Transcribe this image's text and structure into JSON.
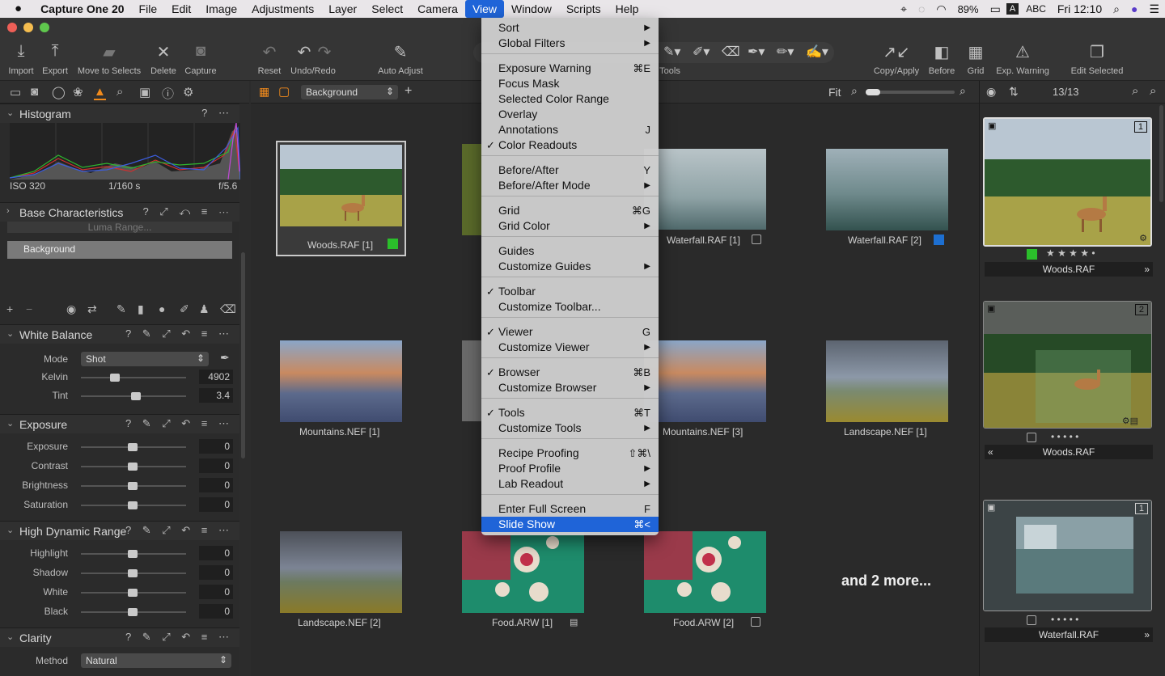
{
  "menubar": {
    "apple": "",
    "app_name": "Capture One 20",
    "items": [
      "File",
      "Edit",
      "Image",
      "Adjustments",
      "Layer",
      "Select",
      "Camera",
      "View",
      "Window",
      "Scripts",
      "Help"
    ],
    "battery": "89%",
    "input": "ABC",
    "clock": "Fri 12:10"
  },
  "toolbar": {
    "import": "Import",
    "export": "Export",
    "move_to_selects": "Move to Selects",
    "delete": "Delete",
    "capture": "Capture",
    "reset": "Reset",
    "undo_redo": "Undo/Redo",
    "auto_adjust": "Auto Adjust",
    "tools": "Tools",
    "copy_apply": "Copy/Apply",
    "before": "Before",
    "grid": "Grid",
    "exp_warning": "Exp. Warning",
    "edit_selected": "Edit Selected"
  },
  "histogram": {
    "title": "Histogram",
    "iso": "ISO 320",
    "shutter": "1/160 s",
    "aperture": "f/5.6"
  },
  "base_characteristics": {
    "title": "Base Characteristics",
    "luma_range": "Luma Range...",
    "layer": "Background"
  },
  "white_balance": {
    "title": "White Balance",
    "mode_label": "Mode",
    "mode_value": "Shot",
    "kelvin_label": "Kelvin",
    "kelvin_value": "4902",
    "tint_label": "Tint",
    "tint_value": "3.4"
  },
  "exposure": {
    "title": "Exposure",
    "rows": [
      {
        "label": "Exposure",
        "value": "0"
      },
      {
        "label": "Contrast",
        "value": "0"
      },
      {
        "label": "Brightness",
        "value": "0"
      },
      {
        "label": "Saturation",
        "value": "0"
      }
    ]
  },
  "hdr": {
    "title": "High Dynamic Range",
    "rows": [
      {
        "label": "Highlight",
        "value": "0"
      },
      {
        "label": "Shadow",
        "value": "0"
      },
      {
        "label": "White",
        "value": "0"
      },
      {
        "label": "Black",
        "value": "0"
      }
    ]
  },
  "clarity": {
    "title": "Clarity",
    "method_label": "Method",
    "method_value": "Natural"
  },
  "browser": {
    "layer_select": "Background",
    "fit": "Fit",
    "more": "and 2 more...",
    "thumbs": [
      {
        "name": "Woods.RAF [1]"
      },
      {
        "name": "Waterfall.RAF [1]"
      },
      {
        "name": "Waterfall.RAF [2]"
      },
      {
        "name": "Mountains.NEF [1]"
      },
      {
        "name": "Mountains.NEF [3]"
      },
      {
        "name": "Landscape.NEF [1]"
      },
      {
        "name": "Landscape.NEF [2]"
      },
      {
        "name": "Food.ARW [1]"
      },
      {
        "name": "Food.ARW [2]"
      }
    ]
  },
  "viewer_panel": {
    "count": "13/13",
    "badge1": "1",
    "badge2": "2",
    "badge3": "1",
    "name1": "Woods.RAF",
    "name2": "Woods.RAF",
    "name3": "Waterfall.RAF",
    "stars": "★ ★ ★ ★ •",
    "dots": "• • • • •"
  },
  "view_menu": {
    "items": [
      {
        "label": "Sort",
        "shortcut": "▶"
      },
      {
        "label": "Global Filters",
        "shortcut": "▶"
      },
      {
        "label": "Exposure Warning",
        "shortcut": "⌘E"
      },
      {
        "label": "Focus Mask",
        "shortcut": ""
      },
      {
        "label": "Selected Color Range",
        "shortcut": ""
      },
      {
        "label": "Overlay",
        "shortcut": ""
      },
      {
        "label": "Annotations",
        "shortcut": "J"
      },
      {
        "label": "Color Readouts",
        "shortcut": "",
        "checked": "✓"
      },
      {
        "label": "Before/After",
        "shortcut": "Y"
      },
      {
        "label": "Before/After Mode",
        "shortcut": "▶"
      },
      {
        "label": "Grid",
        "shortcut": "⌘G"
      },
      {
        "label": "Grid Color",
        "shortcut": "▶"
      },
      {
        "label": "Guides",
        "shortcut": ""
      },
      {
        "label": "Customize Guides",
        "shortcut": "▶"
      },
      {
        "label": "Toolbar",
        "shortcut": "",
        "checked": "✓"
      },
      {
        "label": "Customize Toolbar...",
        "shortcut": ""
      },
      {
        "label": "Viewer",
        "shortcut": "G",
        "checked": "✓"
      },
      {
        "label": "Customize Viewer",
        "shortcut": "▶"
      },
      {
        "label": "Browser",
        "shortcut": "⌘B",
        "checked": "✓"
      },
      {
        "label": "Customize Browser",
        "shortcut": "▶"
      },
      {
        "label": "Tools",
        "shortcut": "⌘T",
        "checked": "✓"
      },
      {
        "label": "Customize Tools",
        "shortcut": "▶"
      },
      {
        "label": "Recipe Proofing",
        "shortcut": "⇧⌘\\"
      },
      {
        "label": "Proof Profile",
        "shortcut": "▶"
      },
      {
        "label": "Lab Readout",
        "shortcut": "▶"
      },
      {
        "label": "Enter Full Screen",
        "shortcut": "F"
      },
      {
        "label": "Slide Show",
        "shortcut": "⌘<"
      }
    ]
  },
  "colors": {
    "accent": "#1f64d8",
    "tag_green": "#2bbf2b",
    "tag_blue": "#1d6fd1",
    "orange": "#f08a1c"
  }
}
